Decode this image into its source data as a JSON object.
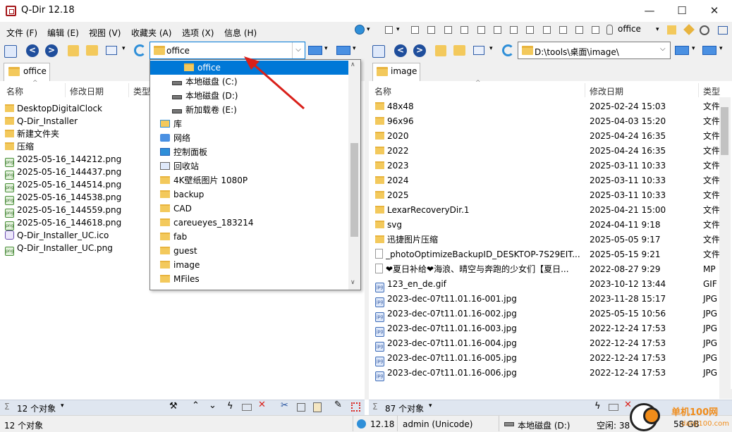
{
  "window": {
    "title": "Q-Dir 12.18",
    "minimize": "—",
    "maximize": "☐",
    "close": "✕"
  },
  "menu": [
    "文件 (F)",
    "编辑 (E)",
    "视图 (V)",
    "收藏夹 (A)",
    "选项 (X)",
    "信息 (H)"
  ],
  "toolbar": {
    "favorite_label": "office",
    "expand": "▾"
  },
  "left": {
    "address": "office",
    "tab": "office",
    "columns": [
      "名称",
      "修改日期",
      "类型"
    ],
    "files": [
      {
        "name": "DesktopDigitalClock",
        "icon": "folder"
      },
      {
        "name": "Q-Dir_Installer",
        "icon": "folder"
      },
      {
        "name": "新建文件夹",
        "icon": "folder"
      },
      {
        "name": "压缩",
        "icon": "folder"
      },
      {
        "name": "2025-05-16_144212.png",
        "icon": "png"
      },
      {
        "name": "2025-05-16_144437.png",
        "icon": "png"
      },
      {
        "name": "2025-05-16_144514.png",
        "icon": "png"
      },
      {
        "name": "2025-05-16_144538.png",
        "icon": "png"
      },
      {
        "name": "2025-05-16_144559.png",
        "icon": "png"
      },
      {
        "name": "2025-05-16_144618.png",
        "icon": "png"
      },
      {
        "name": "Q-Dir_Installer_UC.ico",
        "icon": "ico"
      },
      {
        "name": "Q-Dir_Installer_UC.png",
        "icon": "png"
      }
    ],
    "status": "12 个对象"
  },
  "dropdown": [
    {
      "label": "office",
      "icon": "folder",
      "selected": true,
      "indent": 2
    },
    {
      "label": "本地磁盘 (C:)",
      "icon": "drive",
      "indent": 1
    },
    {
      "label": "本地磁盘 (D:)",
      "icon": "drive",
      "indent": 1
    },
    {
      "label": "新加载卷 (E:)",
      "icon": "drive",
      "indent": 1
    },
    {
      "label": "库",
      "icon": "library",
      "indent": 0
    },
    {
      "label": "网络",
      "icon": "network",
      "indent": 0
    },
    {
      "label": "控制面板",
      "icon": "control-panel",
      "indent": 0
    },
    {
      "label": "回收站",
      "icon": "recycle-bin",
      "indent": 0
    },
    {
      "label": "4K壁纸图片 1080P",
      "icon": "folder",
      "indent": 0
    },
    {
      "label": "backup",
      "icon": "folder",
      "indent": 0
    },
    {
      "label": "CAD",
      "icon": "folder",
      "indent": 0
    },
    {
      "label": "careueyes_183214",
      "icon": "folder",
      "indent": 0
    },
    {
      "label": "fab",
      "icon": "folder",
      "indent": 0
    },
    {
      "label": "guest",
      "icon": "folder",
      "indent": 0
    },
    {
      "label": "image",
      "icon": "folder",
      "indent": 0
    },
    {
      "label": "MFiles",
      "icon": "folder",
      "indent": 0
    }
  ],
  "right": {
    "address": "D:\\tools\\桌面\\image\\",
    "tab": "image",
    "columns": [
      "名称",
      "修改日期",
      "类型"
    ],
    "files": [
      {
        "name": "48x48",
        "date": "2025-02-24 15:03",
        "type": "文件",
        "icon": "folder"
      },
      {
        "name": "96x96",
        "date": "2025-04-03 15:20",
        "type": "文件",
        "icon": "folder"
      },
      {
        "name": "2020",
        "date": "2025-04-24 16:35",
        "type": "文件",
        "icon": "folder"
      },
      {
        "name": "2022",
        "date": "2025-04-24 16:35",
        "type": "文件",
        "icon": "folder"
      },
      {
        "name": "2023",
        "date": "2025-03-11 10:33",
        "type": "文件",
        "icon": "folder"
      },
      {
        "name": "2024",
        "date": "2025-03-11 10:33",
        "type": "文件",
        "icon": "folder"
      },
      {
        "name": "2025",
        "date": "2025-03-11 10:33",
        "type": "文件",
        "icon": "folder"
      },
      {
        "name": "LexarRecoveryDir.1",
        "date": "2025-04-21 15:00",
        "type": "文件",
        "icon": "folder"
      },
      {
        "name": "svg",
        "date": "2024-04-11 9:18",
        "type": "文件",
        "icon": "folder"
      },
      {
        "name": "迅捷图片压缩",
        "date": "2025-05-05 9:17",
        "type": "文件",
        "icon": "folder"
      },
      {
        "name": "_photoOptimizeBackupID_DESKTOP-7S29EIT...",
        "date": "2025-05-15 9:21",
        "type": "文件",
        "icon": "file"
      },
      {
        "name": "❤夏日补给❤海浪、晴空与奔跑的少女们【夏日...",
        "date": "2022-08-27 9:29",
        "type": "MP",
        "icon": "file"
      },
      {
        "name": "123_en_de.gif",
        "date": "2023-10-12 13:44",
        "type": "GIF",
        "icon": "jpg"
      },
      {
        "name": "2023-dec-07t11.01.16-001.jpg",
        "date": "2023-11-28 15:17",
        "type": "JPG",
        "icon": "jpg"
      },
      {
        "name": "2023-dec-07t11.01.16-002.jpg",
        "date": "2025-05-15 10:56",
        "type": "JPG",
        "icon": "jpg"
      },
      {
        "name": "2023-dec-07t11.01.16-003.jpg",
        "date": "2022-12-24 17:53",
        "type": "JPG",
        "icon": "jpg"
      },
      {
        "name": "2023-dec-07t11.01.16-004.jpg",
        "date": "2022-12-24 17:53",
        "type": "JPG",
        "icon": "jpg"
      },
      {
        "name": "2023-dec-07t11.01.16-005.jpg",
        "date": "2022-12-24 17:53",
        "type": "JPG",
        "icon": "jpg"
      },
      {
        "name": "2023-dec-07t11.01.16-006.jpg",
        "date": "2022-12-24 17:53",
        "type": "JPG",
        "icon": "jpg"
      }
    ],
    "status": "87 个对象"
  },
  "statusbar": {
    "objects": "12 个对象",
    "version": "12.18",
    "user": "admin (Unicode)",
    "drive": "本地磁盘 (D:)",
    "space": "空闲: 38",
    "space_total": "58 GB"
  },
  "watermark": {
    "text": "单机100网",
    "url": "danji100.com"
  },
  "colors": {
    "accent": "#0078d7",
    "arrow": "#d9201a",
    "status_bg": "#dfe6f0"
  }
}
